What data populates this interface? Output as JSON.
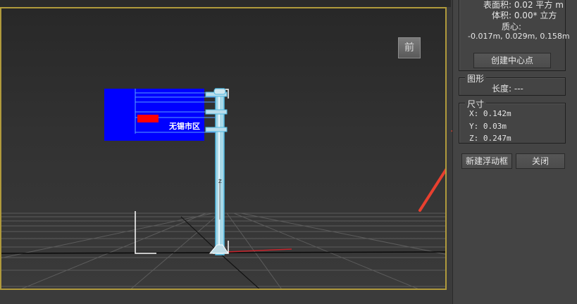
{
  "viewport": {
    "viewcube_label": "前",
    "sign_text": "无锡市区",
    "pole_marker": "Z"
  },
  "panel": {
    "surface_area": "表面积: 0.02 平方 m",
    "volume": "体积: 0.00* 立方",
    "centroid_label": "质心:",
    "centroid_value": "-0.017m, 0.029m, 0.158m",
    "create_center_button": "创建中心点",
    "shape_group": {
      "title": "图形",
      "length": "长度: ---"
    },
    "size_group": {
      "title": "尺寸",
      "x": "X:  0.142m",
      "y": "Y:  0.03m",
      "z": "Z:  0.247m"
    },
    "new_float_button": "新建浮动框",
    "close_button": "关闭"
  },
  "colors": {
    "viewport_border": "#b09a3c",
    "sign_blue": "#0000ff",
    "sign_red": "#ff0000",
    "annotation_arrow": "#e8402f"
  }
}
